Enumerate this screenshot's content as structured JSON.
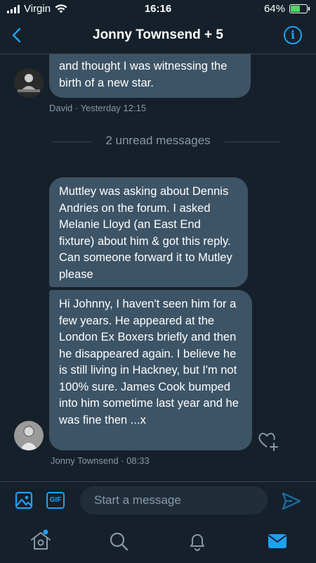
{
  "status_bar": {
    "carrier": "Virgin",
    "time": "16:16",
    "battery": "64%",
    "battery_level": 0.64
  },
  "header": {
    "title": "Jonny Townsend + 5"
  },
  "messages": [
    {
      "text": "and thought I was witnessing the birth of a new star.",
      "sender": "David",
      "timestamp": "· Yesterday 12:15"
    }
  ],
  "unread_divider": "2 unread messages",
  "unread_messages": [
    {
      "text": "Muttley was asking about Dennis Andries on the forum. I asked Melanie Lloyd (an East End fixture) about him & got this reply. Can someone forward it to Mutley please"
    },
    {
      "text": "Hi Johnny, I haven't seen him for a few years. He appeared at the London Ex Boxers briefly and then he disappeared again. I believe he is still living in Hackney, but I'm not 100% sure. James Cook bumped into him sometime last year and he was fine then ...x"
    }
  ],
  "last_sender": {
    "name": "Jonny Townsend",
    "timestamp": "· 08:33"
  },
  "composer": {
    "placeholder": "Start a message",
    "gif_label": "GIF"
  },
  "tabbar": {
    "items": [
      "home",
      "search",
      "notifications",
      "messages"
    ],
    "active": "messages"
  },
  "colors": {
    "background": "#15202b",
    "bubble": "#3d5466",
    "accent": "#1da1f2",
    "muted": "#8899a6"
  }
}
